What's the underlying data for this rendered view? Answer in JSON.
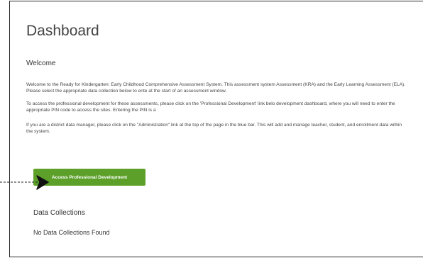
{
  "dashboard": {
    "title": "Dashboard",
    "welcome_heading": "Welcome",
    "paragraphs": [
      "Welcome to the Ready for Kindergarten: Early Childhood Comprehensive Assessment System. This assessment system Assessment (KRA) and the Early Learning Assessment (ELA). Please select the appropriate data collection below to ente at the start of an assessment window.",
      "To access the professional development for these assessments, please click on the 'Professional Development' link belo development dashboard, where you will need to enter the appropriate PIN code to access the sites. Entering the PIN is a",
      "If you are a district data manager, please click on the \"Administration\" link at the top of the page in the blue bar. This will add and manage teacher, student, and enrollment data within the system."
    ],
    "pd_button_label": "Access Professional Development",
    "data_collections_heading": "Data Collections",
    "no_data_collections": "No Data Collections Found"
  },
  "icons": {
    "pointer": "arrow-pointer-icon"
  },
  "colors": {
    "button_green": "#5ca02a",
    "frame_border": "#2a2a2a",
    "text": "#444444"
  }
}
